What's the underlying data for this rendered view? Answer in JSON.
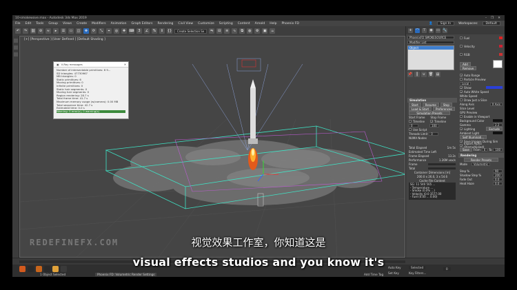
{
  "window": {
    "title": "10-smokewave.max - Autodesk 3ds Max 2019",
    "controls": [
      "–",
      "❐",
      "✕"
    ]
  },
  "menubar": {
    "items": [
      "File",
      "Edit",
      "Tools",
      "Group",
      "Views",
      "Create",
      "Modifiers",
      "Animation",
      "Graph Editors",
      "Rendering",
      "Civil View",
      "Customize",
      "Scripting",
      "Content",
      "Arnold",
      "Help",
      "Phoenix FD"
    ],
    "sign_in": "Sign In",
    "workspaces_label": "Workspaces:",
    "workspaces_value": "Default"
  },
  "toolbar": {
    "selection_set": "Create Selection Se"
  },
  "viewport": {
    "label": "[+] [Perspective ] [User Defined ] [Default Shading ]",
    "watermark": "REDEFINEFX.COM"
  },
  "vray_messages": {
    "title": "V-Ray messages",
    "lines": [
      "Number of intersectable primitives: 6 9...",
      "SD triangles: 47730967",
      "MB triangles: 0",
      "Static primitives: 6",
      "Moving primitives: 0",
      "Infinite primitives: 0",
      "Static hair segments: 0",
      "Moving hair segments: 0",
      "Region rendering: 28.7 s",
      "Total frame time: 41.7 s",
      "Maximum memory usage (w/camera): 0.00 MB",
      "Total sequence time: 42.7 s",
      "Estimated time: 0.0 s",
      "Warning: 0 error(s), 0 warning(s)"
    ]
  },
  "command_panel": {
    "object_name": "PhoenixFD SMOKESOURCE",
    "modifier_list": "Modifier List",
    "stack_item": "Object",
    "simulation": {
      "title": "Simulation",
      "start": "Start",
      "resume": "Resume",
      "stop": "Stop",
      "load_start": "Load & Start",
      "preferences": "Preferences",
      "presets": "Simulation Presets",
      "start_frame_label": "Start Frame",
      "stop_frame_label": "Stop Frame",
      "start_frame": "0",
      "stop_frame": "100",
      "timeline": "Timeline",
      "use_script": "Use Script",
      "threads_label": "Threads Limit",
      "threads": "0",
      "numa": "NUMA Nodes",
      "total_elapsed_label": "Total Elapsed",
      "total_elapsed": "1m 5s",
      "est_time_left_label": "Estimated Time Left",
      "frame_elapsed_label": "Frame Elapsed",
      "frame_elapsed": "13.2s",
      "performance_label": "Performance",
      "performance": "1.26M vox/s",
      "frame_label": "Frame",
      "total_label": "Total",
      "container_label": "Container Dimensions [m]",
      "container_dims": "200.0 x 26.0, 3 x 54.6",
      "cache_label": "Cache File Content",
      "cache_lines": [
        "SG: 11 540 565 ...",
        "- Temperature ...",
        "- Smoke (0.0% ...)",
        "- Velocity (0.0 3577.00",
        "- Fuel (0.00 ... 0.00)"
      ]
    },
    "right_col": {
      "fuel": "Fuel",
      "velocity": "Velocity",
      "rgb": "RGB",
      "add": "Add",
      "remove": "Remove",
      "auto_range": "Auto Range",
      "particle_preview": "Particle Preview",
      "local": "Local",
      "show": "Show",
      "auto_white_speed": "Auto White Speed",
      "white_speed": "White Speed",
      "draw_slice": "Draw Just a Slice",
      "along_axis": "Along Axis",
      "axis": "X Axis",
      "slice_level": "Slice Level",
      "gpu_preview": "GPU Preview",
      "enable_viewport": "Enable in Viewport",
      "background_color": "Background Color",
      "gamma": "Gamma",
      "gamma_value": "2.2",
      "lighting": "Lighting",
      "exclude": "Exclude",
      "ambient_light": "Ambient Light",
      "self_illum": "Self Illuminati...",
      "save_images": "Save Images During Sim",
      "export_alpha": "Export Alpha (Premultiplied)",
      "save_from_label": "Save",
      "from_label": "From",
      "from_value": "0",
      "to_label": "To",
      "to_value": "100",
      "rendering": "Rendering",
      "render_presets": "Render Presets",
      "mode_label": "Mode",
      "mode": "Volumetric",
      "step_label": "Step %",
      "step_value": "90",
      "shadow_step_label": "Shadow Step %",
      "shadow_step_value": "200",
      "fade_out_label": "Fade Out",
      "fade_out_value": "0.0",
      "heat_haze_label": "Heat Haze",
      "heat_haze_value": "0.0"
    }
  },
  "status": {
    "selection": "1 Object Selected",
    "render_tab": "Phoenix FD: Volumetric Render Settings",
    "auto_key": "Auto Key",
    "auto_key_value": "Selected",
    "set_key": "Set Key",
    "key_filters": "Key Filters...",
    "add_time_tag": "Add Time Tag",
    "frame": "0"
  },
  "subtitles": {
    "chinese": "视觉效果工作室，你知道这是",
    "english": "visual effects studios and you know it's"
  }
}
